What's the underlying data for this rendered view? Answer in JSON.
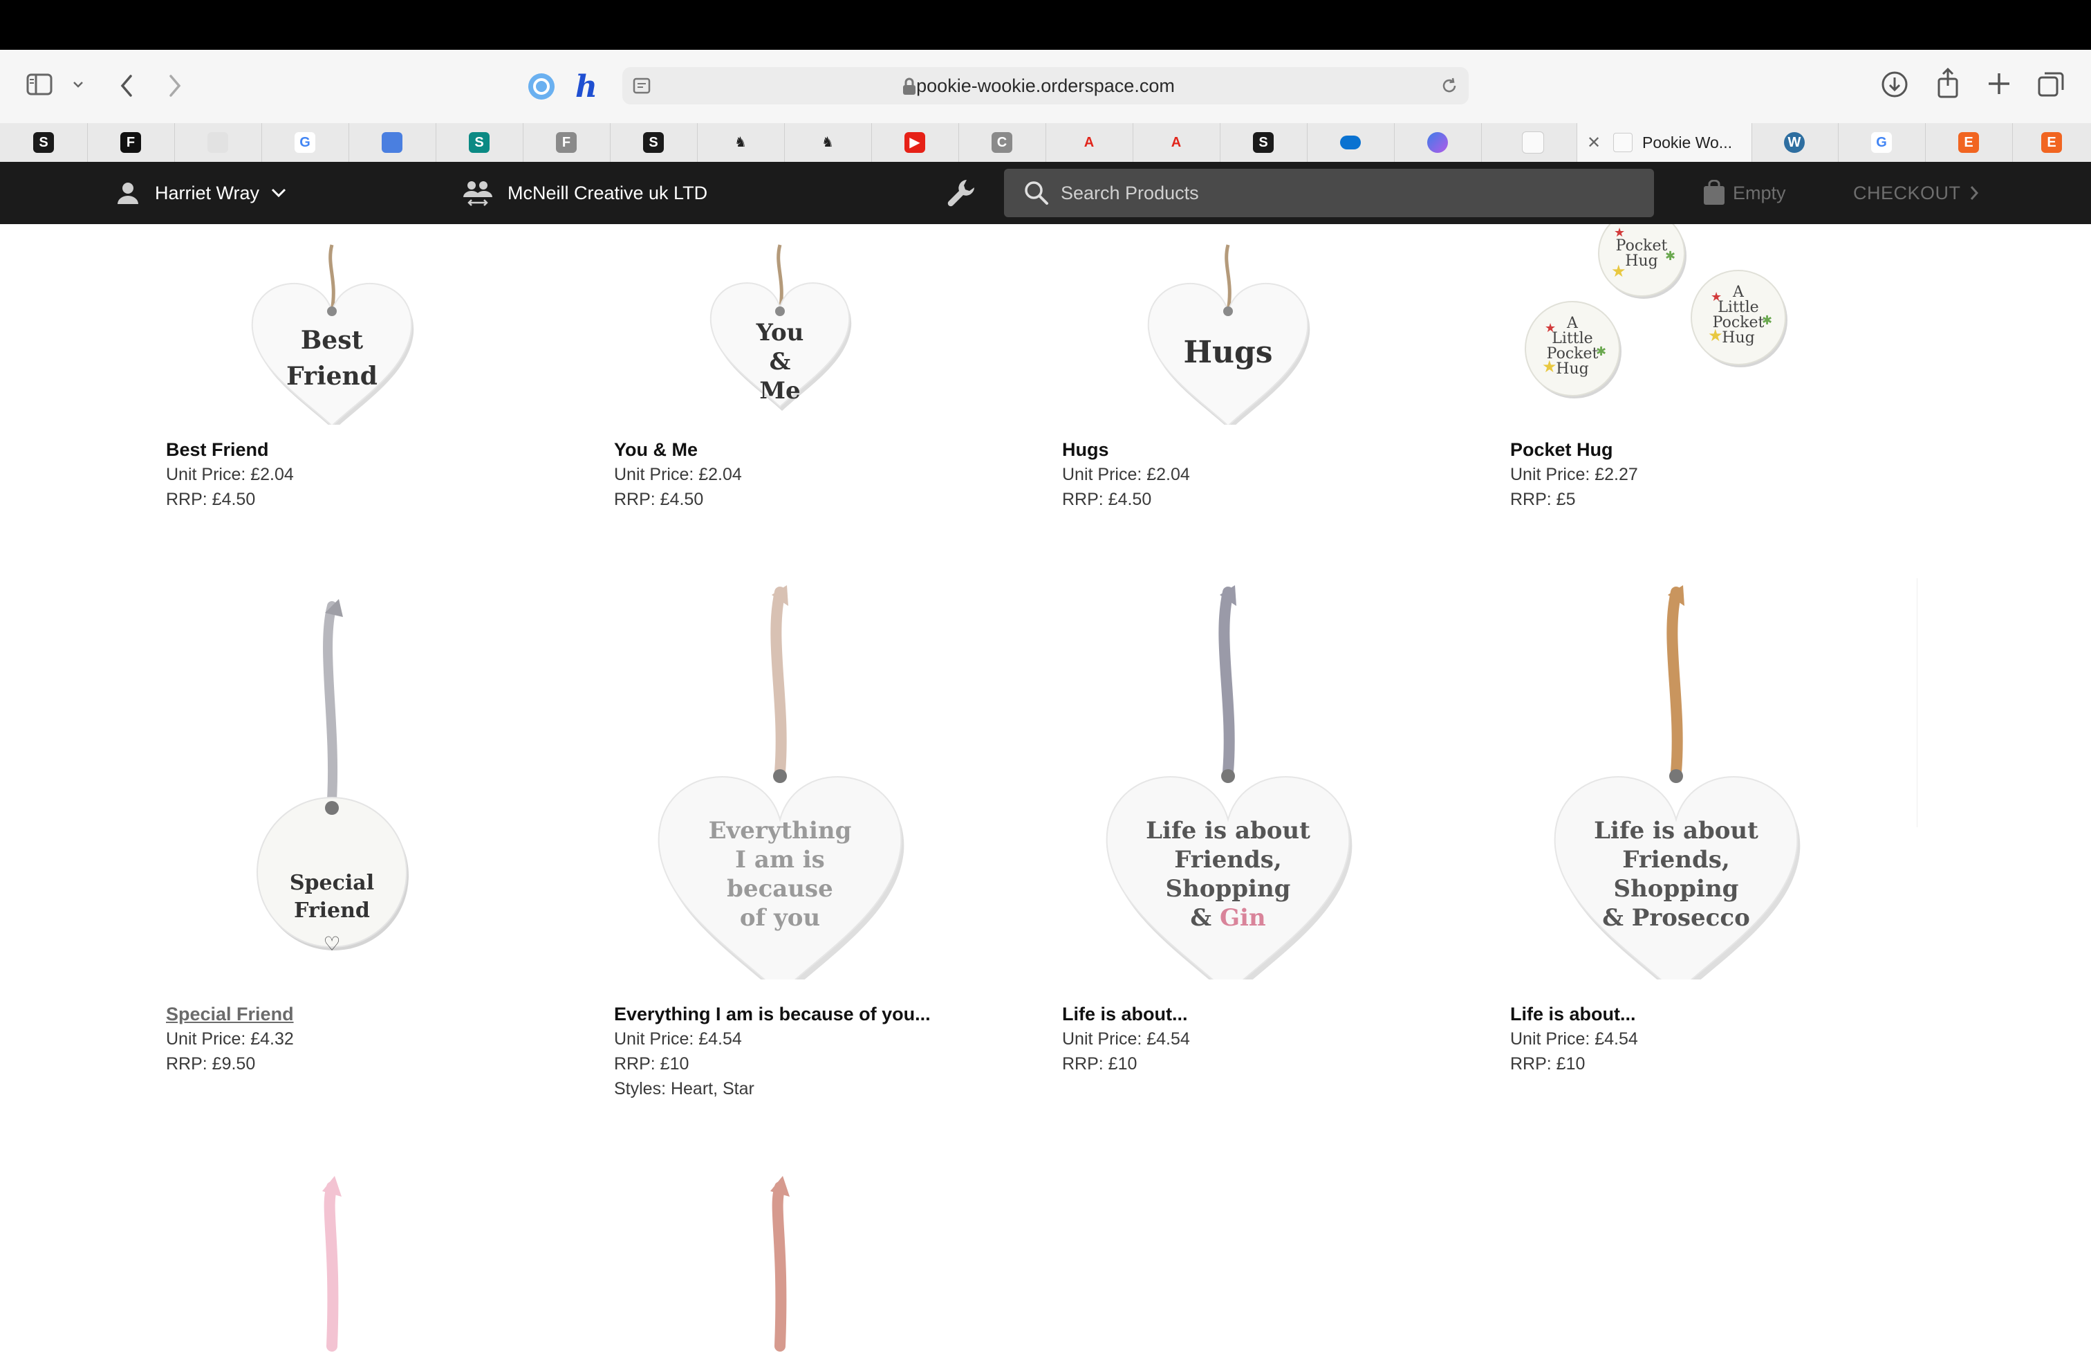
{
  "browser": {
    "url": "pookie-wookie.orderspace.com",
    "active_tab_title": "Pookie Wo...",
    "favorites": [
      {
        "icon": "shopify-icon",
        "glyph": "S",
        "bg": "#1a1a1a"
      },
      {
        "icon": "f-icon",
        "glyph": "F",
        "bg": "#111111"
      },
      {
        "icon": "gift-icon",
        "glyph": "",
        "bg": "#e2e2e2"
      },
      {
        "icon": "google-icon",
        "glyph": "G",
        "bg": "#ffffff"
      },
      {
        "icon": "tag-icon",
        "glyph": "",
        "bg": "#4a7fe0"
      },
      {
        "icon": "sharepoint-icon",
        "glyph": "S",
        "bg": "#0b8a84"
      },
      {
        "icon": "f-grey-icon",
        "glyph": "F",
        "bg": "#8a8a8a"
      },
      {
        "icon": "shopify-icon",
        "glyph": "S",
        "bg": "#1a1a1a"
      },
      {
        "icon": "horse-icon",
        "glyph": "♞",
        "bg": "#e9e9e9"
      },
      {
        "icon": "horse-icon",
        "glyph": "♞",
        "bg": "#e9e9e9"
      },
      {
        "icon": "youtube-icon",
        "glyph": "▶",
        "bg": "#e62117"
      },
      {
        "icon": "c-icon",
        "glyph": "C",
        "bg": "#8a8a8a"
      },
      {
        "icon": "adobe-icon",
        "glyph": "A",
        "bg": "#e9e9e9"
      },
      {
        "icon": "adobe-icon",
        "glyph": "A",
        "bg": "#e9e9e9"
      },
      {
        "icon": "shopify-icon",
        "glyph": "S",
        "bg": "#1a1a1a"
      },
      {
        "icon": "onedrive-icon",
        "glyph": "",
        "bg": "#e9e9e9"
      },
      {
        "icon": "copilot-icon",
        "glyph": "",
        "bg": "#e9e9e9"
      },
      {
        "icon": "blank-page-icon",
        "glyph": "",
        "bg": "#fafafa"
      }
    ],
    "after_tabs": [
      {
        "icon": "wordpress-icon",
        "glyph": "W",
        "bg": "#2e6ea0"
      },
      {
        "icon": "google-icon",
        "glyph": "G",
        "bg": "#ffffff"
      },
      {
        "icon": "etsy-icon",
        "glyph": "E",
        "bg": "#f16521"
      },
      {
        "icon": "etsy-icon",
        "glyph": "E",
        "bg": "#f16521"
      }
    ]
  },
  "header": {
    "user_name": "Harriet Wray",
    "company": "McNeill Creative uk LTD",
    "search_placeholder": "Search Products",
    "cart_label": "Empty",
    "checkout_label": "CHECKOUT"
  },
  "products": [
    {
      "name": "Best Friend",
      "unit_price": "Unit Price: £2.04",
      "rrp": "RRP: £4.50",
      "art": "heart",
      "text_lines": [
        "Best",
        "Friend"
      ],
      "string_color": "#b49a7a"
    },
    {
      "name": "You & Me",
      "unit_price": "Unit Price: £2.04",
      "rrp": "RRP: £4.50",
      "art": "heart-small",
      "text_lines": [
        "You",
        "&",
        "Me"
      ],
      "string_color": "#b49a7a"
    },
    {
      "name": "Hugs",
      "unit_price": "Unit Price: £2.04",
      "rrp": "RRP: £4.50",
      "art": "heart",
      "text_lines": [
        "Hugs"
      ],
      "string_color": "#b49a7a"
    },
    {
      "name": "Pocket Hug",
      "unit_price": "Unit Price: £2.27",
      "rrp": "RRP: £5",
      "art": "pocket",
      "text_lines": [
        "A",
        "Little",
        "Pocket",
        "Hug"
      ],
      "string_color": ""
    },
    {
      "name": "Special Friend",
      "unit_price": "Unit Price: £4.32",
      "rrp": "RRP: £9.50",
      "art": "circle",
      "text_lines": [
        "Special",
        "Friend"
      ],
      "string_color": "#b7b7bd",
      "link": true
    },
    {
      "name": "Everything I am is because of you...",
      "unit_price": "Unit Price: £4.54",
      "rrp": "RRP: £10",
      "styles": "Styles: Heart, Star",
      "art": "heart-big",
      "text_lines": [
        "Everything",
        "I am is",
        "because",
        "of you"
      ],
      "string_color": "#d8c1b3"
    },
    {
      "name": "Life is about...",
      "unit_price": "Unit Price: £4.54",
      "rrp": "RRP: £10",
      "art": "heart-big",
      "text_lines": [
        "Life is about",
        "Friends,",
        "Shopping",
        "& Gin"
      ],
      "string_color": "#9a9aa8"
    },
    {
      "name": "Life is about...",
      "unit_price": "Unit Price: £4.54",
      "rrp": "RRP: £10",
      "art": "heart-big",
      "text_lines": [
        "Life is about",
        "Friends,",
        "Shopping",
        "& Prosecco"
      ],
      "string_color": "#c9955e"
    },
    {
      "name": "",
      "unit_price": "",
      "rrp": "",
      "art": "ribbon-only",
      "text_lines": [],
      "string_color": "#f3c3d2"
    },
    {
      "name": "",
      "unit_price": "",
      "rrp": "",
      "art": "ribbon-only",
      "text_lines": [],
      "string_color": "#d69a8e"
    }
  ],
  "colors": {
    "header_bg": "#1b1b1b",
    "search_bg": "#4a4a4a",
    "gin_pink": "#d9849a"
  }
}
